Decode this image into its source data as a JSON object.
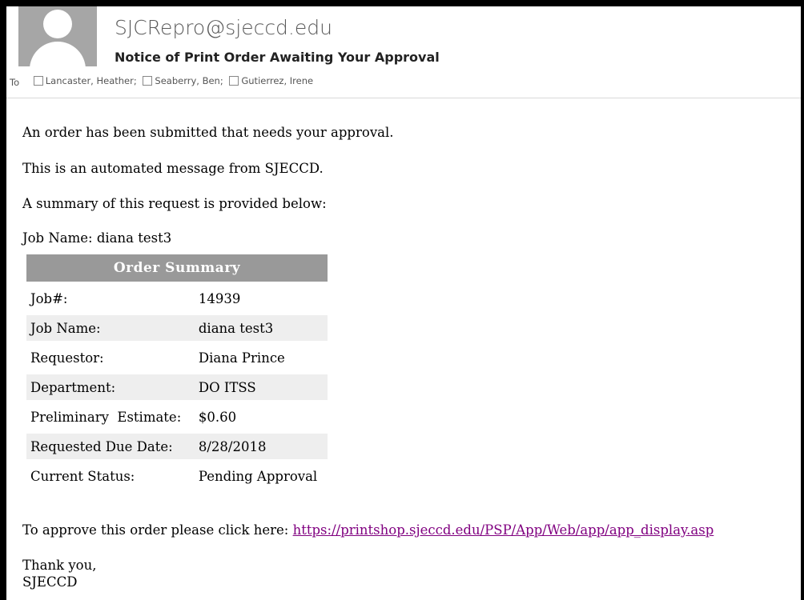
{
  "header": {
    "sender": "SJCRepro@sjeccd.edu",
    "subject": "Notice of Print Order Awaiting Your Approval",
    "to_label": "To",
    "recipients": [
      "Lancaster, Heather;",
      "Seaberry, Ben;",
      "Gutierrez, Irene"
    ]
  },
  "body": {
    "line1": "An order has been submitted that needs your approval.",
    "line2": "This is an automated message from SJECCD.",
    "line3": "A summary of this request is provided below:",
    "job_name_line": "Job Name: diana test3"
  },
  "summary": {
    "title": "Order Summary",
    "rows": [
      {
        "label": "Job#:",
        "value": "14939"
      },
      {
        "label": "Job Name:",
        "value": "diana test3"
      },
      {
        "label": "Requestor:",
        "value": "Diana Prince"
      },
      {
        "label": "Department:",
        "value": "DO ITSS"
      },
      {
        "label": "Preliminary  Estimate:",
        "value": "$0.60"
      },
      {
        "label": "Requested Due Date:",
        "value": "8/28/2018"
      },
      {
        "label": "Current Status:",
        "value": "Pending Approval"
      }
    ]
  },
  "approve": {
    "text": "To approve this order please click here: ",
    "link": "https://printshop.sjeccd.edu/PSP/App/Web/app/app_display.asp",
    "link_color": "#800080"
  },
  "closing": {
    "line1": "Thank you,",
    "line2": "SJECCD"
  }
}
